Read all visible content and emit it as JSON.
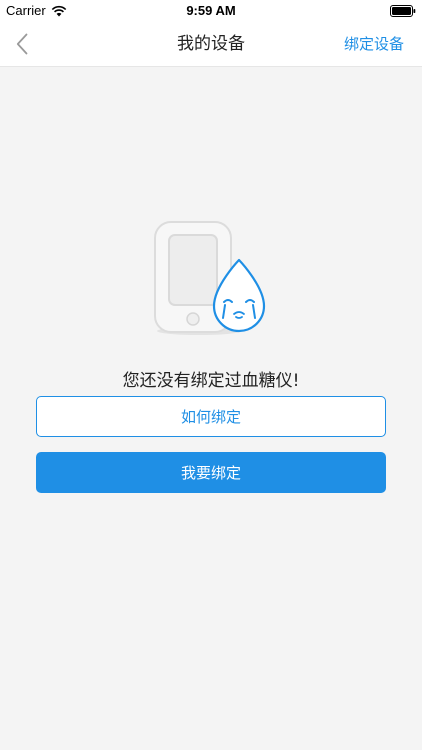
{
  "status_bar": {
    "carrier": "Carrier",
    "time": "9:59 AM"
  },
  "nav": {
    "title": "我的设备",
    "action_label": "绑定设备",
    "back_icon": "chevron-left-icon"
  },
  "empty_state": {
    "illustration": "crying-drop-glucose-meter-illustration",
    "message": "您还没有绑定过血糖仪!",
    "how_to_bind_label": "如何绑定",
    "bind_now_label": "我要绑定"
  },
  "colors": {
    "accent": "#1f8fe5",
    "background": "#f4f4f4",
    "text": "#222222"
  }
}
